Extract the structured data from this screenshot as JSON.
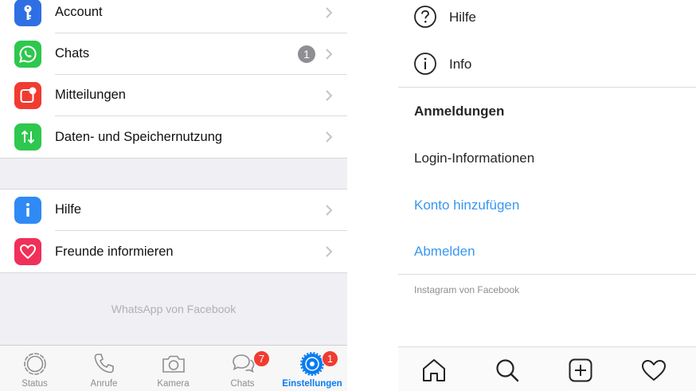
{
  "whatsapp": {
    "group1": [
      {
        "label": "Account",
        "icon": "key-icon",
        "color": "#2f6fe4"
      },
      {
        "label": "Chats",
        "icon": "whatsapp-icon",
        "color": "#2dc84d",
        "badge": "1"
      },
      {
        "label": "Mitteilungen",
        "icon": "notification-icon",
        "color": "#f23b30"
      },
      {
        "label": "Daten- und Speichernutzung",
        "icon": "data-arrows-icon",
        "color": "#2dc84d"
      }
    ],
    "group2": [
      {
        "label": "Hilfe",
        "icon": "info-icon",
        "color": "#2f8af5"
      },
      {
        "label": "Freunde informieren",
        "icon": "heart-icon",
        "color": "#f0305a"
      }
    ],
    "footer": "WhatsApp von Facebook",
    "tabs": [
      {
        "label": "Status",
        "icon": "status-icon"
      },
      {
        "label": "Anrufe",
        "icon": "phone-icon"
      },
      {
        "label": "Kamera",
        "icon": "camera-icon"
      },
      {
        "label": "Chats",
        "icon": "chats-icon",
        "badge": "7"
      },
      {
        "label": "Einstellungen",
        "icon": "settings-icon",
        "badge": "1",
        "active": true
      }
    ]
  },
  "instagram": {
    "menu": [
      {
        "label": "Hilfe",
        "icon": "help-circle-icon"
      },
      {
        "label": "Info",
        "icon": "info-circle-icon"
      }
    ],
    "section_title": "Anmeldungen",
    "login_info": "Login-Informationen",
    "add_account": "Konto hinzufügen",
    "logout": "Abmelden",
    "footer": "Instagram von Facebook",
    "accent": "#3897f0",
    "tabs": [
      "home-icon",
      "search-icon",
      "add-post-icon",
      "activity-heart-icon"
    ]
  }
}
